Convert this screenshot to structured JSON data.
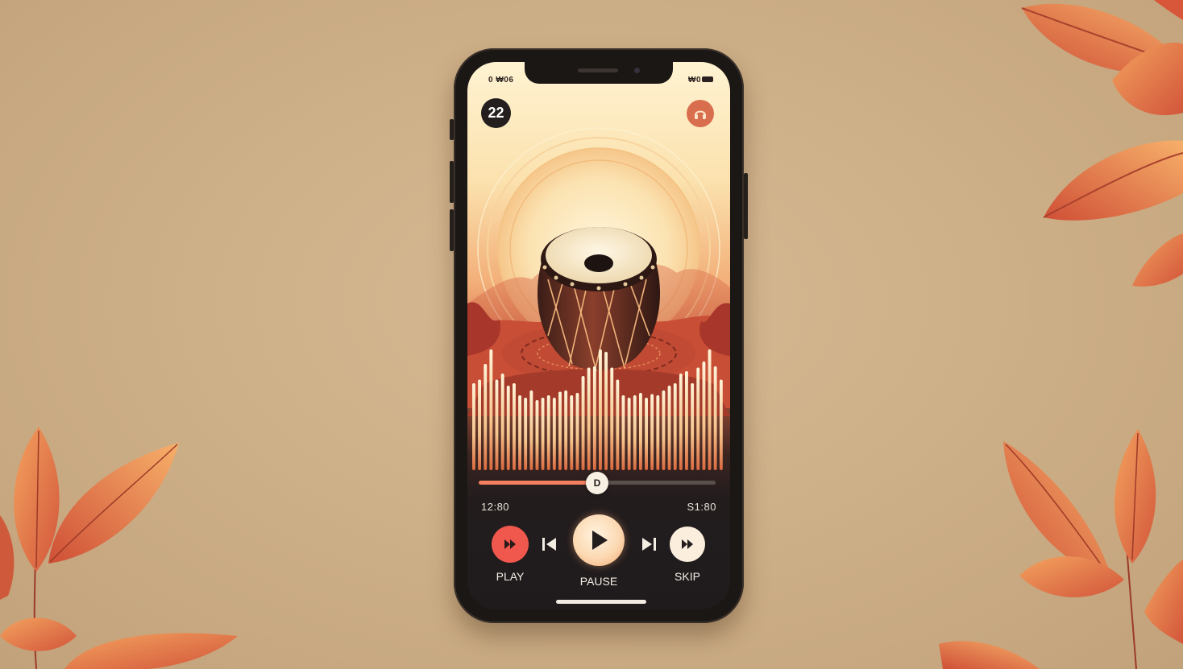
{
  "status_bar": {
    "left": "0 ₩06",
    "right": "₩0"
  },
  "header": {
    "badge": "22",
    "right_icon": "headphones-icon"
  },
  "artwork": {
    "subject": "tabla drum",
    "icon": "drum-icon"
  },
  "visualizer": {
    "levels": [
      0.72,
      0.75,
      0.88,
      1.0,
      0.75,
      0.8,
      0.7,
      0.72,
      0.62,
      0.6,
      0.66,
      0.58,
      0.6,
      0.62,
      0.6,
      0.65,
      0.66,
      0.62,
      0.64,
      0.78,
      0.85,
      0.86,
      1.0,
      0.98,
      0.85,
      0.75,
      0.62,
      0.6,
      0.62,
      0.64,
      0.6,
      0.63,
      0.62,
      0.66,
      0.7,
      0.72,
      0.8,
      0.82,
      0.72,
      0.85,
      0.9,
      1.0,
      0.86,
      0.75
    ]
  },
  "timeline": {
    "progress": 0.5,
    "thumb_label": "D",
    "elapsed": "12:80",
    "total": "S1:80"
  },
  "controls": {
    "left_button_label": "PLAY",
    "center_button_label": "PAUSE",
    "right_button_label": "SKIP"
  },
  "colors": {
    "accent": "#f27f5d",
    "button_coral": "#f0584d",
    "dark": "#1f1b1d",
    "cream": "#fbe6c9"
  }
}
